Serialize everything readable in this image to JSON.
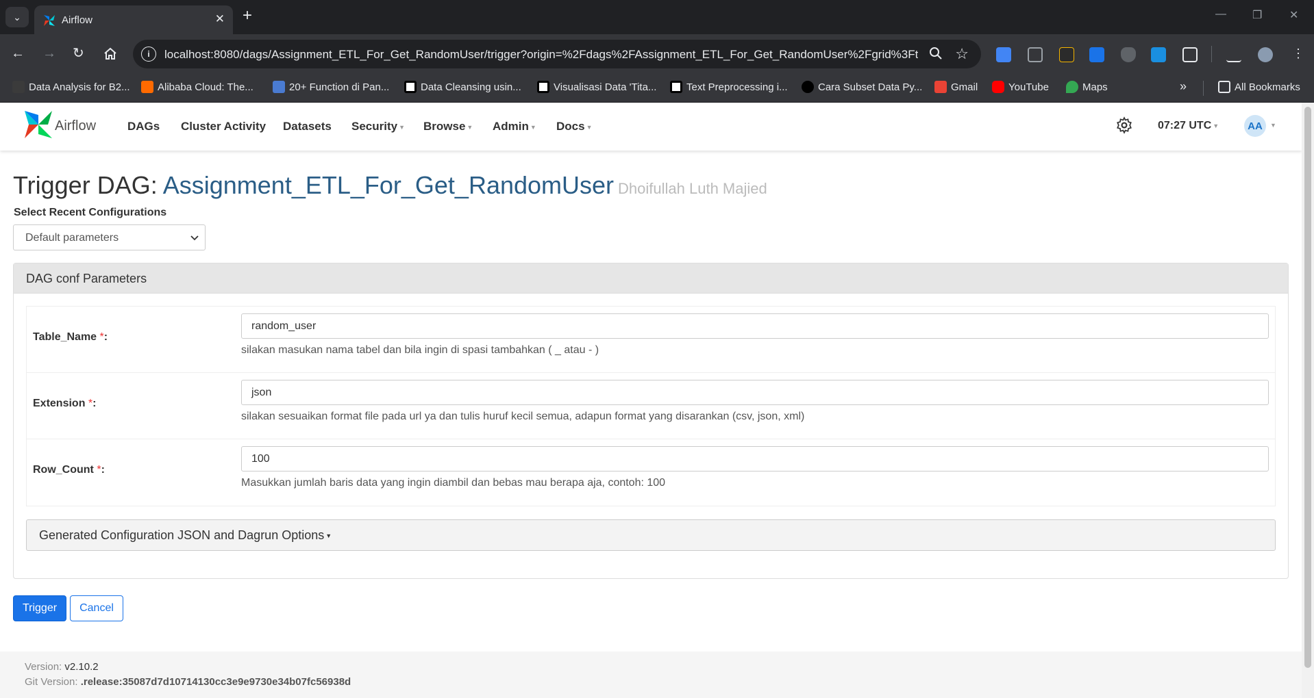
{
  "browser": {
    "tab_title": "Airflow",
    "tab_close": "✕",
    "new_tab": "+",
    "url": "localhost:8080/dags/Assignment_ETL_For_Get_RandomUser/trigger?origin=%2Fdags%2FAssignment_ETL_For_Get_RandomUser%2Fgrid%3Ft...",
    "bookmarks": [
      {
        "label": "Data Analysis for B2...",
        "color": "#3b3b3b"
      },
      {
        "label": "Alibaba Cloud: The...",
        "color": "#ff6a00"
      },
      {
        "label": "20+ Function di Pan...",
        "color": "#4a7bd1"
      },
      {
        "label": "Data Cleansing usin...",
        "color": "#000000"
      },
      {
        "label": "Visualisasi Data 'Tita...",
        "color": "#000000"
      },
      {
        "label": "Text Preprocessing i...",
        "color": "#000000"
      },
      {
        "label": "Cara Subset Data Py...",
        "color": "#000000"
      },
      {
        "label": "Gmail",
        "color": "#ea4335"
      },
      {
        "label": "YouTube",
        "color": "#ff0000"
      },
      {
        "label": "Maps",
        "color": "#34a853"
      }
    ],
    "bookmarks_overflow": "»",
    "all_bookmarks": "All Bookmarks"
  },
  "navbar": {
    "brand": "Airflow",
    "items": [
      {
        "label": "DAGs",
        "dropdown": false
      },
      {
        "label": "Cluster Activity",
        "dropdown": false
      },
      {
        "label": "Datasets",
        "dropdown": false
      },
      {
        "label": "Security",
        "dropdown": true
      },
      {
        "label": "Browse",
        "dropdown": true
      },
      {
        "label": "Admin",
        "dropdown": true
      },
      {
        "label": "Docs",
        "dropdown": true
      }
    ],
    "time": "07:27 UTC",
    "avatar_initials": "AA"
  },
  "page": {
    "title_prefix": "Trigger DAG: ",
    "dag_id": "Assignment_ETL_For_Get_RandomUser",
    "owner": "Dhoifullah Luth Majied",
    "recent_config_label": "Select Recent Configurations",
    "recent_config_value": "Default parameters",
    "panel_title": "DAG conf Parameters",
    "params": [
      {
        "name": "Table_Name",
        "required_mark": "*",
        "value": "random_user",
        "help": "silakan masukan nama tabel dan bila ingin di spasi tambahkan ( _ atau - )"
      },
      {
        "name": "Extension",
        "required_mark": "*",
        "value": "json",
        "help": "silakan sesuaikan format file pada url ya dan tulis huruf kecil semua, adapun format yang disarankan (csv, json, xml)"
      },
      {
        "name": "Row_Count",
        "required_mark": "*",
        "value": "100",
        "help": "Masukkan jumlah baris data yang ingin diambil dan bebas mau berapa aja, contoh: 100"
      }
    ],
    "generated_config_label": "Generated Configuration JSON and Dagrun Options",
    "trigger_label": "Trigger",
    "cancel_label": "Cancel"
  },
  "footer": {
    "version_label": "Version: ",
    "version_value": "v2.10.2",
    "git_label": "Git Version: ",
    "git_value": ".release:35087d7d10714130cc3e9e9730e34b07fc56938d"
  },
  "colors": {
    "accent": "#1a73e8",
    "dag_id": "#2a5d86",
    "required": "#ee3333"
  }
}
